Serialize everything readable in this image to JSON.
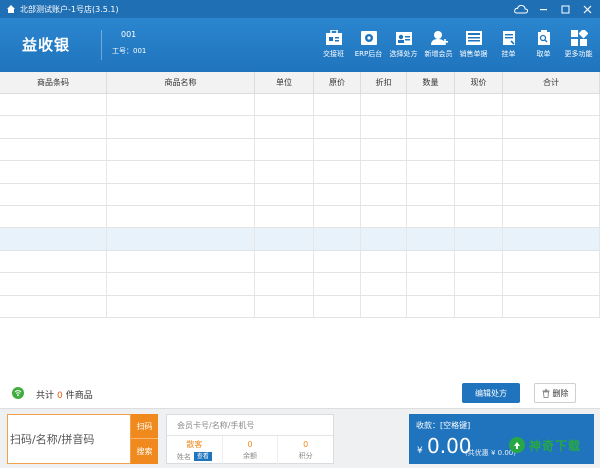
{
  "window": {
    "title": "北部测试账户-1号店(3.5.1)"
  },
  "header": {
    "brand": "益收银",
    "store_no": "001",
    "staff": "工号：001"
  },
  "toolbar": [
    {
      "label": "交接班",
      "icon": "handover-icon"
    },
    {
      "label": "ERP后台",
      "icon": "erp-icon"
    },
    {
      "label": "选择处方",
      "icon": "prescription-icon"
    },
    {
      "label": "新增会员",
      "icon": "add-member-icon"
    },
    {
      "label": "销售单据",
      "icon": "sales-receipt-icon"
    },
    {
      "label": "挂单",
      "icon": "hold-order-icon"
    },
    {
      "label": "取单",
      "icon": "retrieve-order-icon"
    },
    {
      "label": "更多功能",
      "icon": "more-functions-icon"
    }
  ],
  "table": {
    "columns": [
      "商品条码",
      "商品名称",
      "单位",
      "原价",
      "折扣",
      "数量",
      "现价",
      "合计"
    ],
    "row_count": 10,
    "selected_row": 6
  },
  "summary": {
    "prefix": "共计",
    "count": "0",
    "suffix": "件商品",
    "edit_btn": "编辑处方",
    "delete_btn": "删除"
  },
  "scan": {
    "placeholder": "扫码/名称/拼音码",
    "btn_scan": "扫码",
    "btn_search": "搜索"
  },
  "member": {
    "placeholder": "会员卡号/名称/手机号",
    "name_value": "散客",
    "name_label": "姓名",
    "name_tag": "查看",
    "balance_value": "0",
    "balance_label": "余额",
    "points_value": "0",
    "points_label": "积分"
  },
  "payment": {
    "label": "收款：[空格键]",
    "currency": "¥",
    "amount": "0.00",
    "sub": "(共优惠 ¥ 0.00)"
  },
  "watermark": {
    "text": "神奇下载"
  },
  "colors": {
    "primary": "#1f74bd",
    "accent": "#f08a1f",
    "count": "#e55a1c"
  }
}
